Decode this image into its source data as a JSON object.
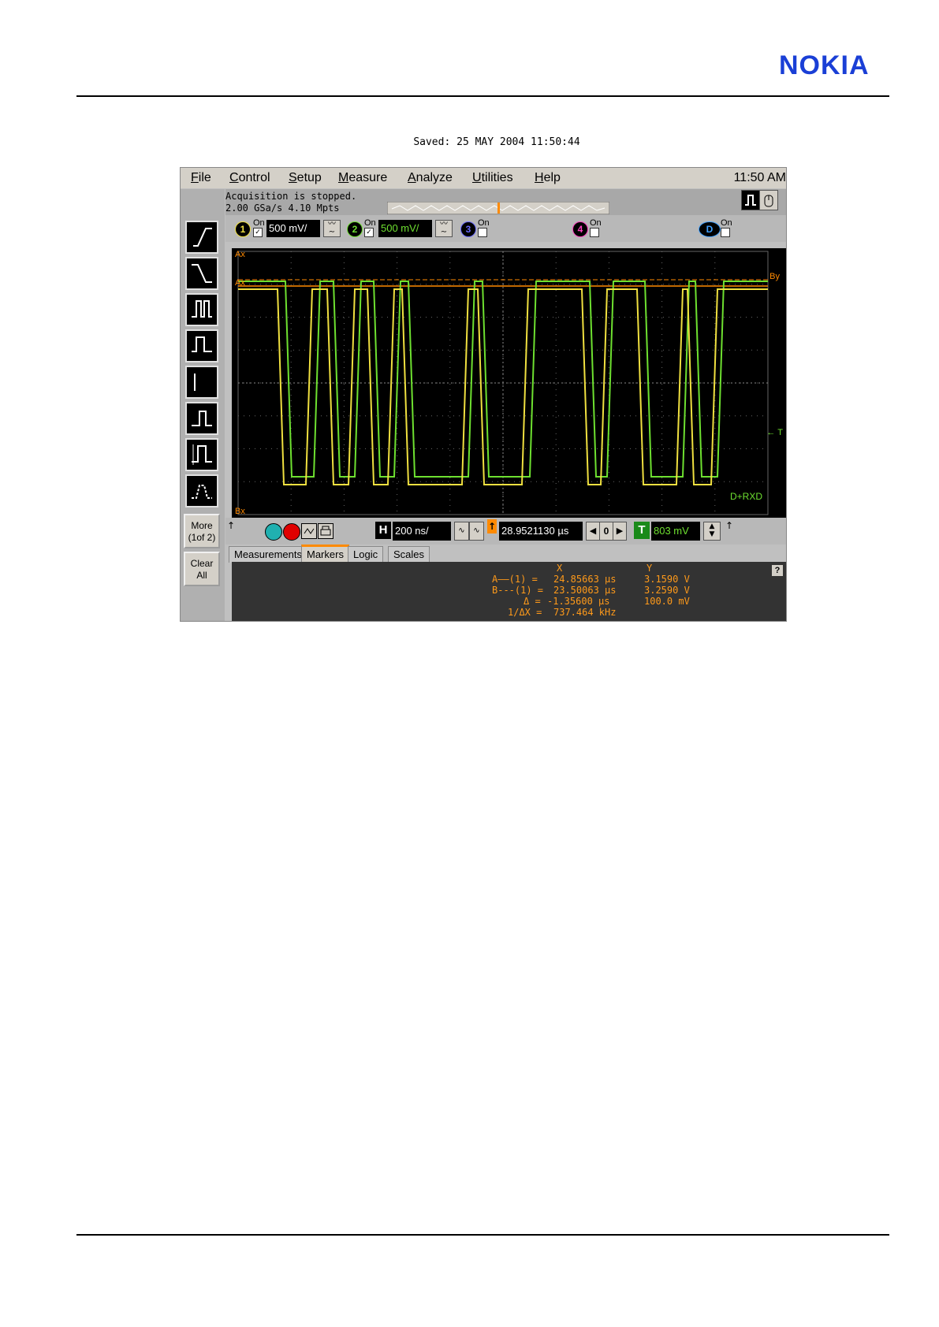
{
  "header": {
    "brand": "NOKIA",
    "saved": "Saved:  25 MAY 2004  11:50:44"
  },
  "menu": {
    "items": [
      "File",
      "Control",
      "Setup",
      "Measure",
      "Analyze",
      "Utilities",
      "Help"
    ],
    "clock": "11:50 AM"
  },
  "status": {
    "line1": "Acquisition is stopped.",
    "line2": "2.00 GSa/s   4.10 Mpts"
  },
  "channels": [
    {
      "num": "1",
      "on_label": "On",
      "checked": true,
      "scale": "500 mV/"
    },
    {
      "num": "2",
      "on_label": "On",
      "checked": true,
      "scale": "500 mV/"
    },
    {
      "num": "3",
      "on_label": "On",
      "checked": false
    },
    {
      "num": "4",
      "on_label": "On",
      "checked": false
    },
    {
      "num": "D",
      "on_label": "On",
      "checked": false
    }
  ],
  "sidebar": {
    "more_line1": "More",
    "more_line2": "(1of 2)",
    "clear_line1": "Clear",
    "clear_line2": "All"
  },
  "waveform": {
    "marker_ax": "Ax",
    "marker_bx": "Bx",
    "marker_by": "By",
    "trigger_label": "← T",
    "trace_label": "D+RXD",
    "colors": {
      "ch1": "#f0e040",
      "ch2": "#6ee030",
      "marker": "#ff8a00",
      "grid": "#666666"
    }
  },
  "controls": {
    "h_label": "H",
    "timebase": "200 ns/",
    "delay": "28.9521130 µs",
    "zero": "0",
    "t_label": "T",
    "trigger_level": "803 mV"
  },
  "tabs": [
    "Measurements",
    "Markers",
    "Logic",
    "Scales"
  ],
  "markers": {
    "hdr_x": "X",
    "hdr_y": "Y",
    "a_label": "A——(1) =",
    "a_x": "24.85663 µs",
    "a_y": "3.1590 V",
    "b_label": "B---(1) =",
    "b_x": "23.50063 µs",
    "b_y": "3.2590 V",
    "d_label": "Δ =",
    "d_x": "-1.35600 µs",
    "d_y": "100.0 mV",
    "inv_label": "1/ΔX =",
    "inv_x": "737.464 kHz",
    "help": "?"
  }
}
